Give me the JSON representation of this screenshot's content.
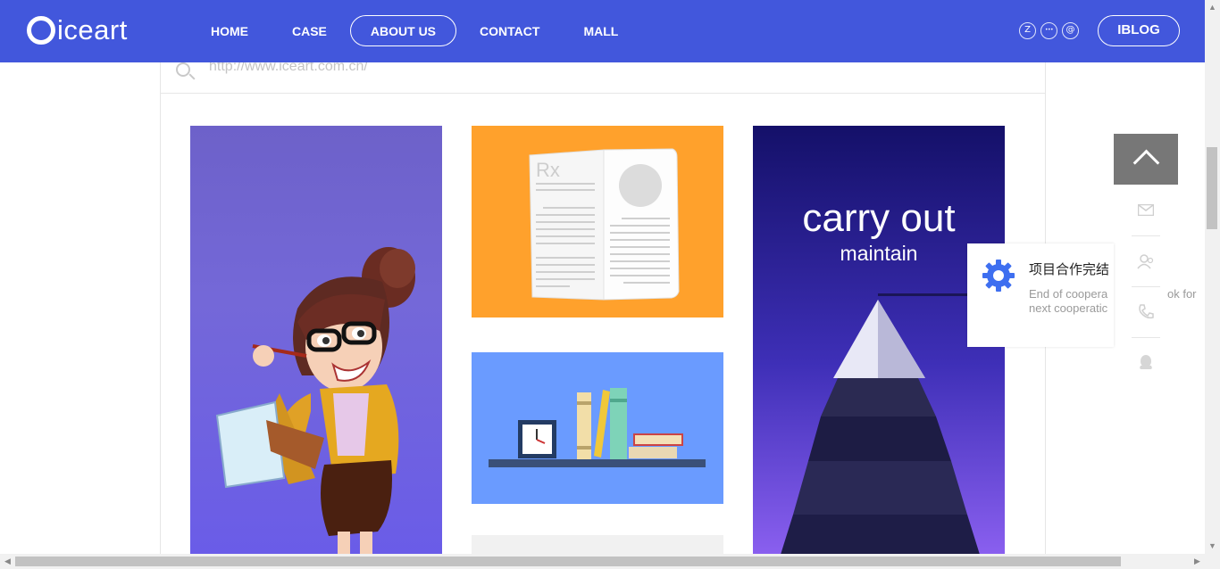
{
  "brand": {
    "logo_text": "iceart"
  },
  "nav": {
    "items": [
      {
        "label": "HOME"
      },
      {
        "label": "CASE"
      },
      {
        "label": "ABOUT US"
      },
      {
        "label": "CONTACT"
      },
      {
        "label": "MALL"
      }
    ],
    "active": "ABOUT US"
  },
  "social": {
    "zhihu": "Z",
    "more": "•••",
    "weibo": "@"
  },
  "iblog": {
    "label": "IBLOG"
  },
  "search": {
    "value": "http://www.iceart.com.cn/"
  },
  "cards": {
    "book": {
      "label": "Rx"
    },
    "tree": {
      "title": "carry out",
      "subtitle": "maintain"
    }
  },
  "tools": {
    "icons": [
      "arrow-up-icon",
      "mail-icon",
      "user-icon",
      "phone-icon",
      "qq-icon"
    ]
  },
  "popup": {
    "title": "项目合作完结",
    "desc_line1": "End of coopera",
    "desc_line2": "next cooperatic",
    "overflow_text": "ok for"
  },
  "colors": {
    "header": "#4257dc",
    "book_bg": "#ffa12c",
    "shelf_bg": "#6a9bff",
    "gear": "#3e6ff0"
  }
}
